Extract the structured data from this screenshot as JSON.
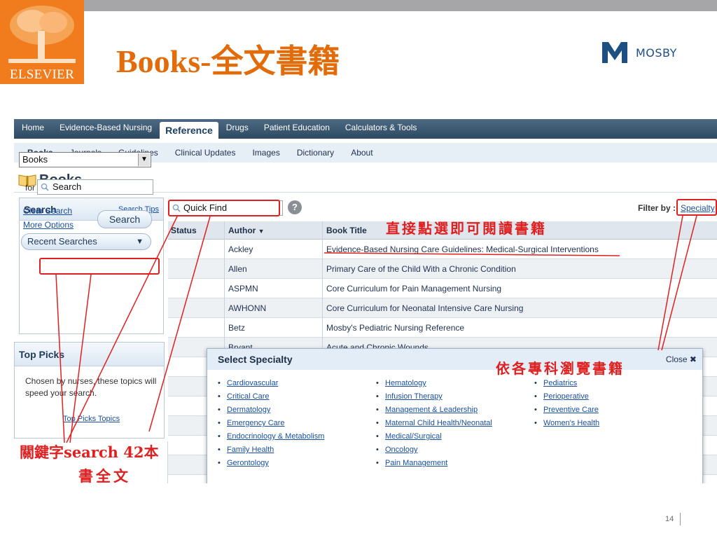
{
  "slide": {
    "title": "Books-全文書籍",
    "logo_text": "ELSEVIER",
    "brand_text": "MOSBY",
    "page_number": "14"
  },
  "nav": {
    "primary": [
      "Home",
      "Evidence-Based Nursing",
      "Reference",
      "Drugs",
      "Patient Education",
      "Calculators & Tools"
    ],
    "primary_active": "Reference",
    "secondary": [
      "Books",
      "Journals",
      "Guidelines",
      "Clinical Updates",
      "Images",
      "Dictionary",
      "About"
    ],
    "secondary_active": "Books"
  },
  "page": {
    "title": "Books"
  },
  "search_panel": {
    "title": "Search",
    "tips_link": "Search Tips",
    "scope_select": "Books",
    "for_label": "for",
    "query_placeholder": "Search",
    "clear_link": "Clear Search",
    "more_link": "More Options",
    "search_button": "Search",
    "recent_button": "Recent Searches"
  },
  "top_picks": {
    "title": "Top Picks",
    "description": "Chosen by nurses, these topics will speed your search.",
    "link": "Top Picks Topics"
  },
  "quick_find": {
    "placeholder": "Quick Find",
    "help_icon": "?"
  },
  "filter": {
    "label": "Filter by :",
    "link": "Specialty"
  },
  "table": {
    "headers": {
      "status": "Status",
      "author": "Author",
      "title": "Book Title"
    },
    "rows": [
      {
        "author": "Ackley",
        "title": "Evidence-Based Nursing Care Guidelines: Medical-Surgical Interventions"
      },
      {
        "author": "Allen",
        "title": "Primary Care of the Child With a Chronic Condition"
      },
      {
        "author": "ASPMN",
        "title": "Core Curriculum for Pain Management Nursing"
      },
      {
        "author": "AWHONN",
        "title": "Core Curriculum for Neonatal Intensive Care Nursing"
      },
      {
        "author": "Betz",
        "title": "Mosby's Pediatric Nursing Reference"
      },
      {
        "author": "Bryant",
        "title": "Acute and Chronic Wounds"
      }
    ]
  },
  "specialty_popup": {
    "title": "Select Specialty",
    "close": "Close ✖",
    "col1": [
      "Cardiovascular",
      "Critical Care",
      "Dermatology",
      "Emergency Care",
      "Endocrinology & Metabolism",
      "Family Health",
      "Gerontology"
    ],
    "col2": [
      "Hematology",
      "Infusion Therapy",
      "Management & Leadership",
      "Maternal Child Health/Neonatal",
      "Medical/Surgical",
      "Oncology",
      "Pain Management"
    ],
    "col3": [
      "Pediatrics",
      "Perioperative",
      "Preventive Care",
      "Women's Health"
    ]
  },
  "annotations": {
    "click_read": "直接點選即可閱讀書籍",
    "browse_specialty": "依各專科瀏覽書籍",
    "keyword_line1": "關鍵字search  42本",
    "keyword_line2": "書全文"
  },
  "colors": {
    "accent_orange": "#e26b0a",
    "elsevier_orange": "#f07c1e",
    "annotation_red": "#e02020",
    "nav_dark": "#2d4a62",
    "link_blue": "#1a4fa0"
  }
}
